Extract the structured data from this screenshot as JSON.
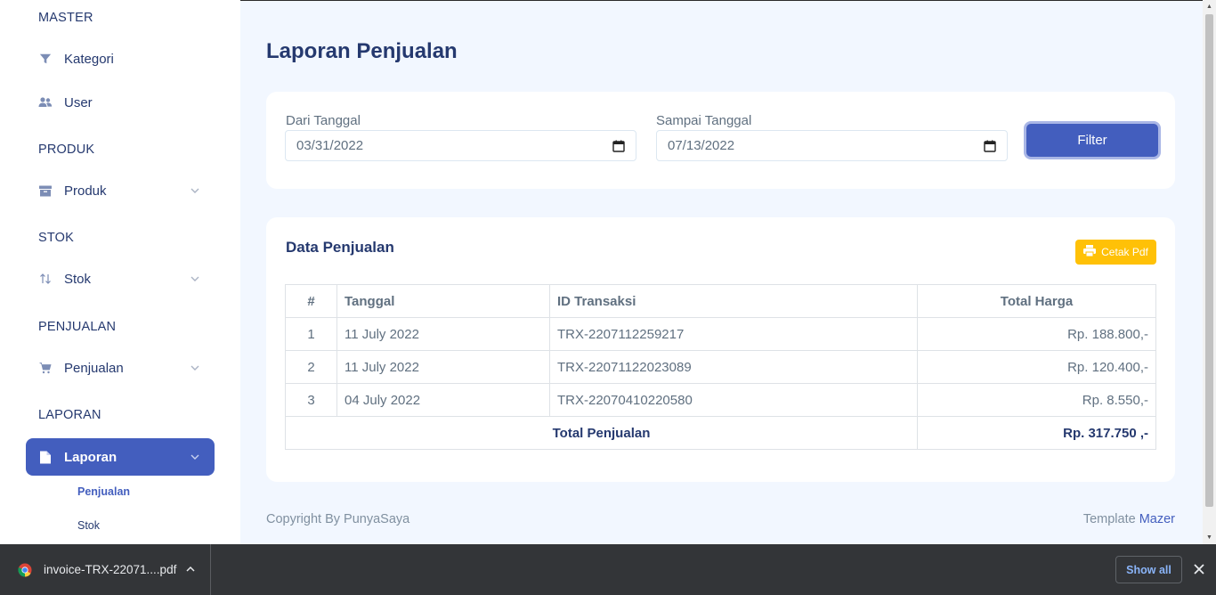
{
  "sidebar": {
    "sections": {
      "master": "MASTER",
      "produk": "PRODUK",
      "stok": "STOK",
      "penjualan": "PENJUALAN",
      "laporan": "LAPORAN"
    },
    "items": {
      "kategori": "Kategori",
      "user": "User",
      "produk": "Produk",
      "stok": "Stok",
      "penjualan": "Penjualan",
      "laporan": "Laporan"
    },
    "submenu": {
      "penjualan": "Penjualan",
      "stok": "Stok"
    }
  },
  "page": {
    "title": "Laporan Penjualan"
  },
  "filter": {
    "from_label": "Dari Tanggal",
    "from_value": "03/31/2022",
    "to_label": "Sampai Tanggal",
    "to_value": "07/13/2022",
    "button": "Filter"
  },
  "report": {
    "title": "Data Penjualan",
    "print_button": "Cetak Pdf",
    "columns": {
      "no": "#",
      "tanggal": "Tanggal",
      "id": "ID Transaksi",
      "total": "Total Harga"
    },
    "rows": [
      {
        "no": "1",
        "tanggal": "11 July 2022",
        "id": "TRX-2207112259217",
        "total": "Rp. 188.800,-"
      },
      {
        "no": "2",
        "tanggal": "11 July 2022",
        "id": "TRX-22071122023089",
        "total": "Rp. 120.400,-"
      },
      {
        "no": "3",
        "tanggal": "04 July 2022",
        "id": "TRX-22070410220580",
        "total": "Rp. 8.550,-"
      }
    ],
    "summary_label": "Total Penjualan",
    "summary_value": "Rp. 317.750 ,-"
  },
  "footer": {
    "copyright": "Copyright By PunyaSaya",
    "template_text": "Template",
    "template_link": "Mazer"
  },
  "downloads": {
    "file_name": "invoice-TRX-22071....pdf",
    "show_all": "Show all"
  },
  "colors": {
    "primary": "#435ebe",
    "warning": "#ffc107",
    "background": "#f2f7ff",
    "text_dark": "#25396f"
  }
}
